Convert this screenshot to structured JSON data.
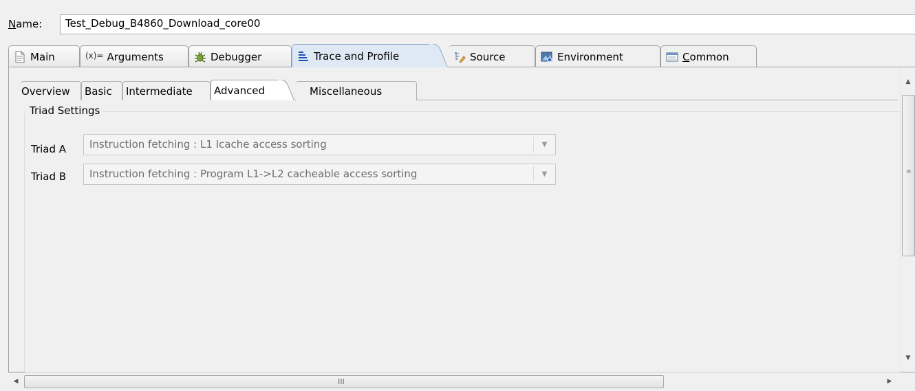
{
  "name_field": {
    "label_mnemonic": "N",
    "label_rest": "ame:",
    "value": "Test_Debug_B4860_Download_core00"
  },
  "outer_tabs": [
    {
      "label": "Main",
      "icon": "document-icon"
    },
    {
      "label": "Arguments",
      "icon": "variable-icon",
      "icon_text": "(x)="
    },
    {
      "label": "Debugger",
      "icon": "bug-icon"
    },
    {
      "label": "Trace and Profile",
      "icon": "trace-icon",
      "active": true
    },
    {
      "label": "Source",
      "icon": "source-icon"
    },
    {
      "label": "Environment",
      "icon": "environment-icon"
    },
    {
      "label_mnemonic": "C",
      "label_rest": "ommon",
      "icon": "common-icon"
    }
  ],
  "inner_tabs": [
    {
      "label": "Overview"
    },
    {
      "label": "Basic"
    },
    {
      "label": "Intermediate"
    },
    {
      "label": "Advanced",
      "active": true
    },
    {
      "label": "Miscellaneous"
    }
  ],
  "triad_settings": {
    "title": "Triad Settings",
    "triad_a": {
      "label": "Triad A",
      "value": "Instruction fetching : L1 Icache access sorting"
    },
    "triad_b": {
      "label": "Triad B",
      "value": "Instruction fetching : Program L1->L2 cacheable access sorting"
    }
  },
  "scrollbar": {
    "horizontal_grip": "III",
    "vertical_grip": "≡"
  },
  "colors": {
    "active_tab_bg": "#dfe9f5",
    "active_tab_border": "#8da8cc",
    "disabled_text": "#6d6d6d"
  }
}
